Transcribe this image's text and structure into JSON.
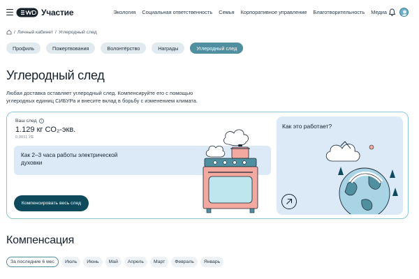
{
  "header": {
    "brand": "Участие",
    "nav": [
      "Экология",
      "Социальная ответственность",
      "Семья",
      "Корпоративное управление",
      "Благотворительность",
      "Медиа"
    ]
  },
  "breadcrumb": {
    "items": [
      "Личный кабинет",
      "Углеродный след"
    ]
  },
  "tabs": [
    {
      "label": "Профиль",
      "active": false
    },
    {
      "label": "Пожертвования",
      "active": false
    },
    {
      "label": "Волонтёрство",
      "active": false
    },
    {
      "label": "Награды",
      "active": false
    },
    {
      "label": "Углеродный след",
      "active": true
    }
  ],
  "page": {
    "title": "Углеродный след",
    "description": "Любая доставка оставляет углеродный след. Компенсируйте его с помощью углеродных единиц СИБУРа и внесите вклад в борьбу с изменением климата."
  },
  "footprint": {
    "label": "Ваш след",
    "value": "1.129 кг CO₂-экв.",
    "sub": "0.0011 УЕ",
    "fact": "Как 2–3 часа работы электрической духовки",
    "button": "Компенсировать весь след"
  },
  "how_it_works": {
    "title": "Как это работает?"
  },
  "compensation": {
    "title": "Компенсация",
    "periods": [
      {
        "label": "За последние 6 мес",
        "active": true
      },
      {
        "label": "Июль",
        "active": false
      },
      {
        "label": "Июнь",
        "active": false
      },
      {
        "label": "Май",
        "active": false
      },
      {
        "label": "Апрель",
        "active": false
      },
      {
        "label": "Март",
        "active": false
      },
      {
        "label": "Февраль",
        "active": false
      },
      {
        "label": "Январь",
        "active": false
      }
    ]
  },
  "colors": {
    "accent": "#4f8fa0",
    "button_dark": "#0e4a5b",
    "card_border": "#8cc6d6",
    "panel_blue": "#dce9f7"
  }
}
